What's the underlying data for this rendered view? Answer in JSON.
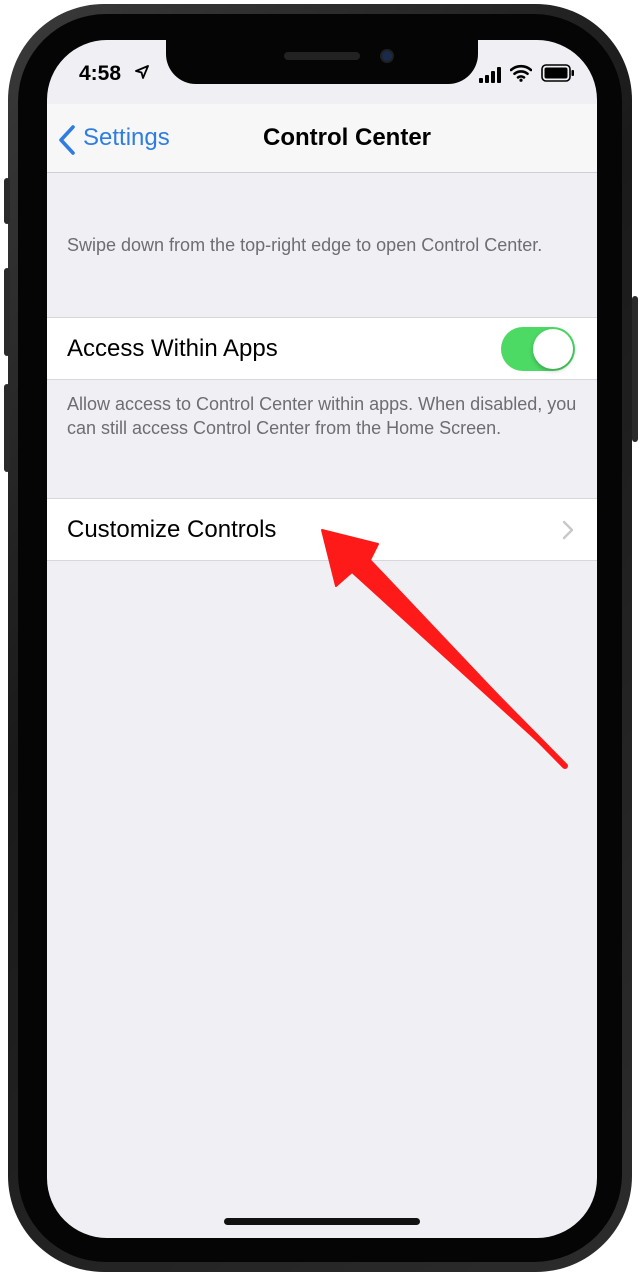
{
  "status_bar": {
    "time": "4:58"
  },
  "nav": {
    "back_label": "Settings",
    "title": "Control Center"
  },
  "content": {
    "intro_text": "Swipe down from the top-right edge to open Control Center.",
    "access_within_apps": {
      "label": "Access Within Apps",
      "enabled": true
    },
    "access_footer": "Allow access to Control Center within apps. When disabled, you can still access Control Center from the Home Screen.",
    "customize_controls": {
      "label": "Customize Controls"
    }
  },
  "colors": {
    "accent": "#2f7de1",
    "toggle_on": "#4cd964",
    "background": "#efeff4",
    "annotation_arrow": "#ff1a1a"
  },
  "icons": [
    "location-arrow-icon",
    "cellular-signal-icon",
    "wifi-icon",
    "battery-icon",
    "back-chevron-icon",
    "chevron-right-icon"
  ]
}
